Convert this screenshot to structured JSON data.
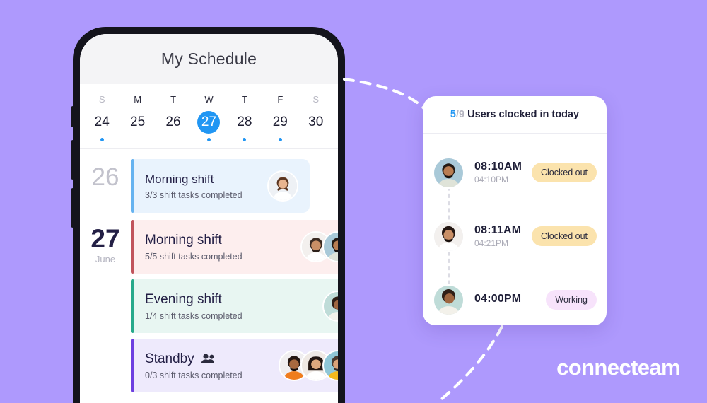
{
  "theme": {
    "background": "#AE99FD",
    "accent_blue": "#2196F3",
    "text_dark": "#231F45"
  },
  "phone": {
    "header": {
      "title": "My Schedule"
    },
    "week": {
      "days": [
        {
          "letter": "S",
          "number": "24",
          "active": false,
          "dot": true,
          "weekend": true
        },
        {
          "letter": "M",
          "number": "25",
          "active": false,
          "dot": false,
          "weekend": false
        },
        {
          "letter": "T",
          "number": "26",
          "active": false,
          "dot": false,
          "weekend": false
        },
        {
          "letter": "W",
          "number": "27",
          "active": true,
          "dot": true,
          "weekend": false
        },
        {
          "letter": "T",
          "number": "28",
          "active": false,
          "dot": true,
          "weekend": false
        },
        {
          "letter": "F",
          "number": "29",
          "active": false,
          "dot": true,
          "weekend": false
        },
        {
          "letter": "S",
          "number": "30",
          "active": false,
          "dot": false,
          "weekend": true
        }
      ]
    },
    "schedule": [
      {
        "date_number": "26",
        "date_month": "",
        "today": false,
        "shift": {
          "title": "Morning shift",
          "subtitle": "3/3 shift tasks completed",
          "color": "blue",
          "group_icon": false,
          "avatars": 1
        }
      },
      {
        "date_number": "27",
        "date_month": "June",
        "today": true,
        "shift": {
          "title": "Morning shift",
          "subtitle": "5/5 shift tasks completed",
          "color": "red",
          "group_icon": false,
          "avatars": 2
        }
      },
      {
        "date_number": "",
        "date_month": "",
        "today": false,
        "shift": {
          "title": "Evening shift",
          "subtitle": "1/4 shift tasks completed",
          "color": "green",
          "group_icon": false,
          "avatars": 1
        }
      },
      {
        "date_number": "",
        "date_month": "",
        "today": false,
        "shift": {
          "title": "Standby",
          "subtitle": "0/3 shift tasks completed",
          "color": "purple",
          "group_icon": true,
          "avatars": 3
        }
      }
    ]
  },
  "panel": {
    "header": {
      "count_done": "5",
      "count_sep": "/",
      "count_total": "9",
      "text": "Users clocked in today"
    },
    "rows": [
      {
        "clock_in": "08:10AM",
        "clock_out": "04:10PM",
        "status": "Clocked out",
        "status_style": "amber"
      },
      {
        "clock_in": "08:11AM",
        "clock_out": "04:21PM",
        "status": "Clocked out",
        "status_style": "amber"
      },
      {
        "clock_in": "04:00PM",
        "clock_out": "",
        "status": "Working",
        "status_style": "pink"
      }
    ]
  },
  "logo": {
    "name": "connecteam"
  }
}
